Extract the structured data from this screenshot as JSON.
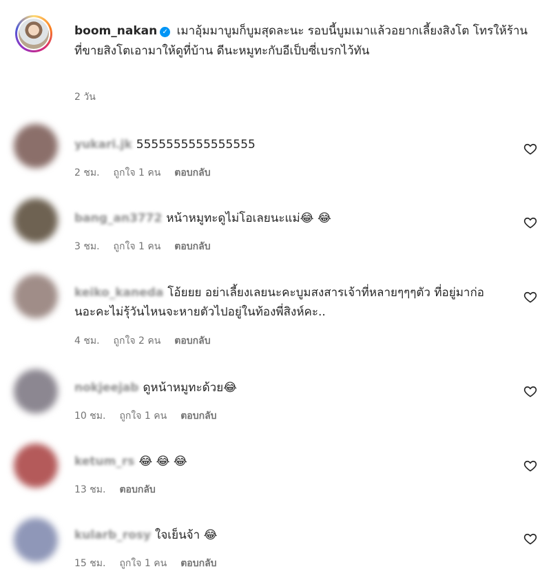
{
  "post": {
    "username": "boom_nakan",
    "verified_icon": "✓",
    "caption": "เมาอุ้มมาบูมก็บูมสุดละนะ รอบนี้บูมเมาแล้วอยากเลี้ยงสิงโต โทรให้ร้านที่ขายสิงโตเอามาให้ดูที่บ้าน ดีนะหมูทะกับอีเป็บซี่เบรกไว้ทัน",
    "time": "2 วัน"
  },
  "comments": [
    {
      "username": "yukari.jk",
      "text": "5555555555555555",
      "time": "2 ชม.",
      "likes": "ถูกใจ 1 คน",
      "reply": "ตอบกลับ",
      "avatar_color": "#8b6f6a"
    },
    {
      "username": "bang_an3772",
      "text": "หน้าหมูทะดูไม่โอเลยนะแม่😂 😂",
      "time": "3 ชม.",
      "likes": "ถูกใจ 1 คน",
      "reply": "ตอบกลับ",
      "avatar_color": "#6e6252"
    },
    {
      "username": "keiko_kaneda",
      "text": "โอ้ยยย อย่าเลี้ยงเลยนะคะบูมสงสารเจ้าที่หลายๆๆๆตัว ที่อยู่มาก่อนอะคะไม่รุ้วันไหนจะหายตัวไปอยู่ในท้องพี่สิงห์คะ..",
      "time": "4 ชม.",
      "likes": "ถูกใจ 2 คน",
      "reply": "ตอบกลับ",
      "avatar_color": "#a08d88"
    },
    {
      "username": "nokjeejab",
      "text": "ดูหน้าหมูทะด้วย😂",
      "time": "10 ชม.",
      "likes": "ถูกใจ 1 คน",
      "reply": "ตอบกลับ",
      "avatar_color": "#8c8791"
    },
    {
      "username": "ketum_rs",
      "text": "😂 😂 😂",
      "time": "13 ชม.",
      "likes": "",
      "reply": "ตอบกลับ",
      "avatar_color": "#b45a5a"
    },
    {
      "username": "kularb_rosy",
      "text": "ใจเย็นจ้า 😂",
      "time": "15 ชม.",
      "likes": "ถูกใจ 1 คน",
      "reply": "ตอบกลับ",
      "avatar_color": "#8f97b8"
    }
  ],
  "icons": {
    "like": "heart-outline-icon",
    "verified": "verified-badge-icon"
  }
}
